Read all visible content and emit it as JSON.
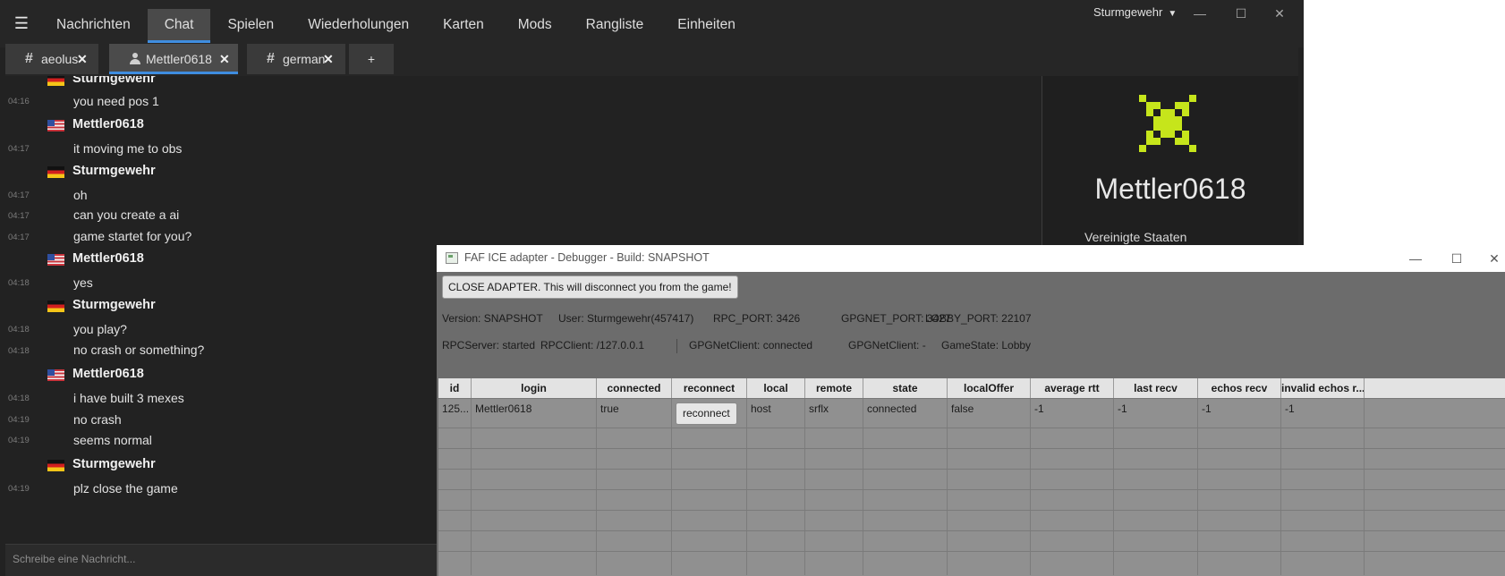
{
  "client": {
    "nav": [
      "Nachrichten",
      "Chat",
      "Spielen",
      "Wiederholungen",
      "Karten",
      "Mods",
      "Rangliste",
      "Einheiten"
    ],
    "active_nav": "Chat",
    "username": "Sturmgewehr",
    "tabs": [
      {
        "label": "aeolus",
        "icon": "hash-icon",
        "close": "✕"
      },
      {
        "label": "Mettler0618",
        "icon": "user-icon",
        "close": "✕"
      },
      {
        "label": "german",
        "icon": "hash-icon",
        "close": "✕"
      },
      {
        "label": "+"
      }
    ],
    "chat": {
      "authors": {
        "a1": "Sturmgewehr",
        "a2": "Mettler0618",
        "a3": "Sturmgewehr",
        "a4": "Mettler0618",
        "a5": "Sturmgewehr",
        "a6": "Mettler0618",
        "a7": "Sturmgewehr"
      },
      "messages": [
        {
          "time": "04:16",
          "text": "you need pos 1"
        },
        {
          "time": "04:17",
          "text": "it moving me to obs"
        },
        {
          "time": "04:17",
          "text": "oh"
        },
        {
          "time": "04:17",
          "text": "can you create a ai"
        },
        {
          "time": "04:17",
          "text": "game startet for you?"
        },
        {
          "time": "04:18",
          "text": "yes"
        },
        {
          "time": "04:18",
          "text": "you play?"
        },
        {
          "time": "04:18",
          "text": "no crash or something?"
        },
        {
          "time": "04:18",
          "text": "i have built 3 mexes"
        },
        {
          "time": "04:19",
          "text": "no crash"
        },
        {
          "time": "04:19",
          "text": "seems normal"
        },
        {
          "time": "04:19",
          "text": "plz close the game"
        }
      ],
      "placeholder": "Schreibe eine Nachricht..."
    },
    "profile": {
      "name": "Mettler0618",
      "country": "Vereinigte Staaten",
      "avatar_color": "#c6e51b"
    }
  },
  "ice": {
    "title": "FAF ICE adapter - Debugger - Build: SNAPSHOT",
    "close_button": "CLOSE ADAPTER. This will disconnect you from the game!",
    "info": {
      "version": "Version: SNAPSHOT",
      "user": "User: Sturmgewehr(457417)",
      "rpc_port": "RPC_PORT: 3426",
      "gpgnet_port": "GPGNET_PORT: 3427",
      "lobby_port": "LOBBY_PORT: 22107"
    },
    "status": {
      "rpc_server": "RPCServer: started",
      "rpc_client": "RPCClient: /127.0.0.1",
      "gpgnet_client": "GPGNetClient: connected",
      "gpgnet_client2": "GPGNetClient: -",
      "game_state": "GameState: Lobby"
    },
    "table": {
      "headers": [
        "id",
        "login",
        "connected",
        "reconnect",
        "local",
        "remote",
        "state",
        "localOffer",
        "average rtt",
        "last recv",
        "echos recv",
        "invalid echos r..."
      ],
      "row": {
        "id": "125...",
        "login": "Mettler0618",
        "connected": "true",
        "reconnect": "reconnect",
        "local": "host",
        "remote": "srflx",
        "state": "connected",
        "localOffer": "false",
        "average_rtt": "-1",
        "last_recv": "-1",
        "echos_recv": "-1",
        "invalid_echos": "-1"
      }
    }
  }
}
